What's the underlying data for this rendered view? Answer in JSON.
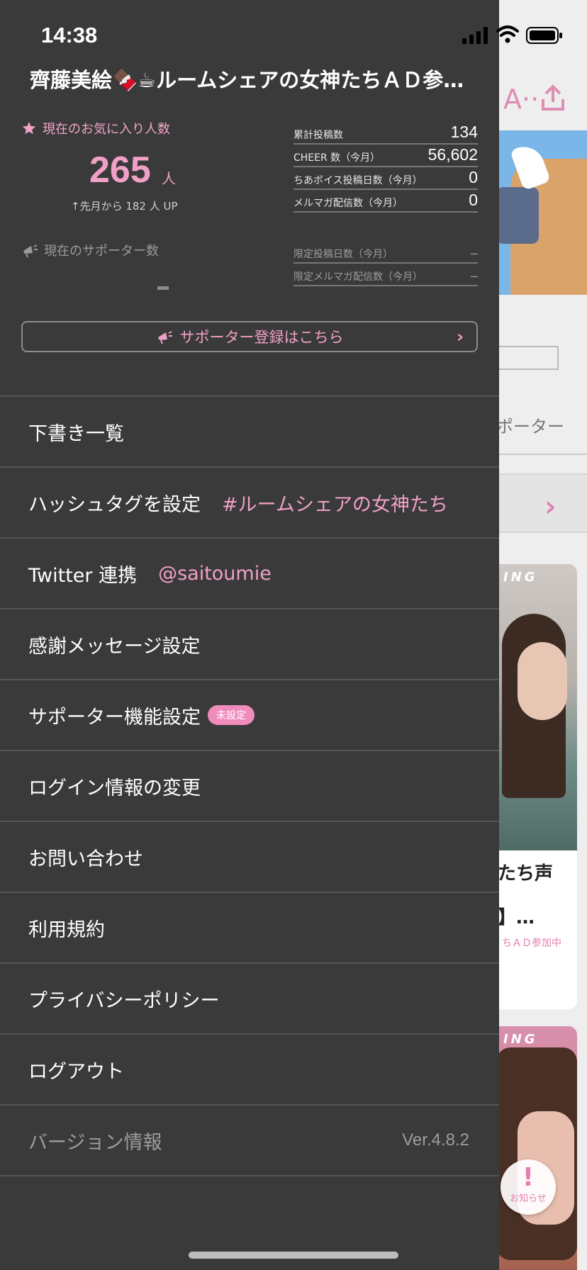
{
  "status_bar": {
    "time": "14:38"
  },
  "drawer": {
    "title": "齊藤美絵🍫☕ルームシェアの女神たちＡＤ参…",
    "favorites": {
      "label": "現在のお気に入り人数",
      "count": "265",
      "unit": "人",
      "change": "↑先月から 182 人 UP"
    },
    "supporters": {
      "label": "現在のサポーター数"
    },
    "stats": [
      {
        "label": "累計投稿数",
        "value": "134"
      },
      {
        "label": "CHEER 数（今月）",
        "value": "56,602"
      },
      {
        "label": "ちあボイス投稿日数（今月）",
        "value": "0"
      },
      {
        "label": "メルマガ配信数（今月）",
        "value": "0"
      }
    ],
    "limited_stats": [
      {
        "label": "限定投稿日数（今月）",
        "value": "–"
      },
      {
        "label": "限定メルマガ配信数（今月）",
        "value": "–"
      }
    ],
    "supporter_button": {
      "label": "サポーター登録はこちら"
    },
    "menu": [
      {
        "label": "下書き一覧"
      },
      {
        "label": "ハッシュタグを設定",
        "accent": "#ルームシェアの女神たち"
      },
      {
        "label": "Twitter 連携",
        "accent": "@saitoumie"
      },
      {
        "label": "感謝メッセージ設定"
      },
      {
        "label": "サポーター機能設定",
        "badge": "未設定"
      },
      {
        "label": "ログイン情報の変更"
      },
      {
        "label": "お問い合わせ"
      },
      {
        "label": "利用規約"
      },
      {
        "label": "プライバシーポリシー"
      },
      {
        "label": "ログアウト"
      },
      {
        "label": "バージョン情報",
        "value": "Ver.4.8.2"
      }
    ]
  },
  "background": {
    "header_text": "A··",
    "supporter_text": "ポーター",
    "card1": {
      "ribbon": "ING",
      "title_line1": "たち声",
      "title_line2": "】…",
      "tag": "ちＡＤ参加中"
    },
    "card2": {
      "ribbon": "ING"
    },
    "notice_button": {
      "mark": "!",
      "label": "お知らせ"
    }
  },
  "colors": {
    "accent": "#f0a0c6",
    "drawer_bg": "#3a3a3a"
  }
}
